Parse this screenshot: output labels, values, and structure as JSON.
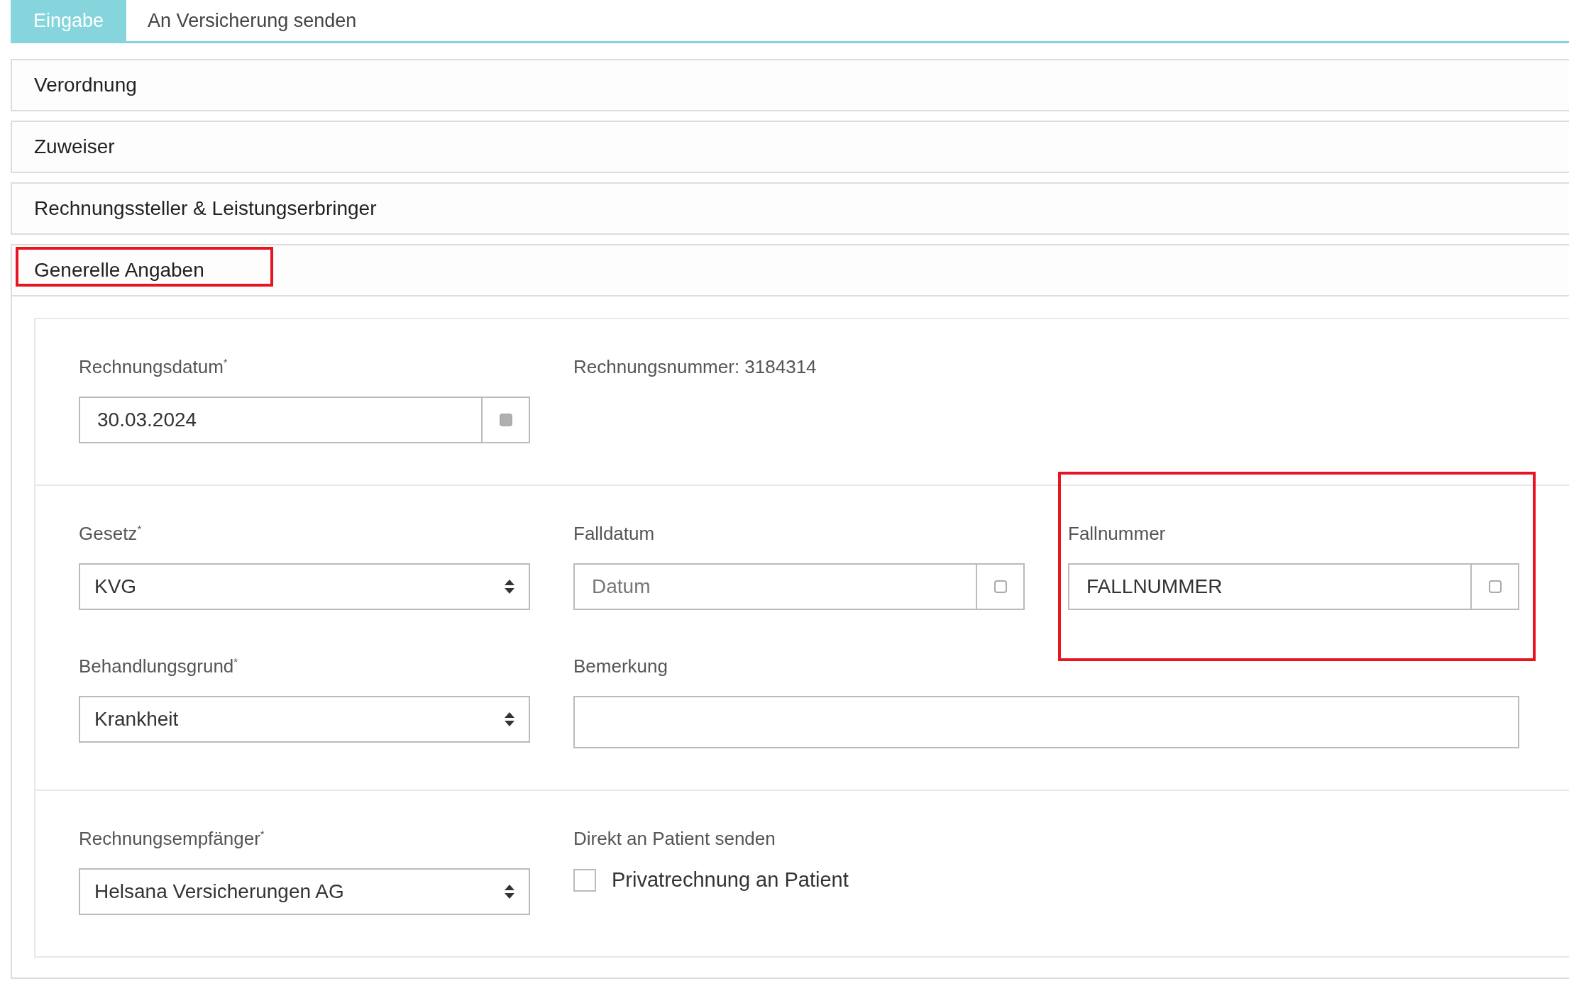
{
  "tabs": [
    {
      "label": "Eingabe",
      "selected": true
    },
    {
      "label": "An Versicherung senden",
      "selected": false
    }
  ],
  "panels": [
    {
      "title": "Verordnung",
      "expanded": false,
      "highlighted": false
    },
    {
      "title": "Zuweiser",
      "expanded": false,
      "highlighted": false
    },
    {
      "title": "Rechnungssteller & Leistungserbringer",
      "expanded": false,
      "highlighted": false
    },
    {
      "title": "Generelle Angaben",
      "expanded": true,
      "highlighted": true
    }
  ],
  "sections": [
    {
      "fields": [
        {
          "kind": "date",
          "label": "Rechnungsdatum$^{*}$",
          "value": "30.03.2024",
          "disabled": true,
          "highlighted": false
        },
        {
          "kind": "info",
          "label": "Rechnungsnummer: 3184314"
        }
      ]
    },
    {
      "fields": [
        {
          "kind": "select",
          "label": "Gesetz$^{*}$",
          "value": "KVG"
        },
        {
          "kind": "date",
          "label": "Falldatum",
          "placeholder": "Datum",
          "disabled": false,
          "highlighted": false
        },
        {
          "kind": "date",
          "label": "Fallnummer",
          "value": "FALLNUMMER",
          "disabled": false,
          "highlighted": true
        },
        {
          "kind": "select",
          "label": "Behandlungsgrund$^{*}$",
          "value": "Krankheit"
        },
        {
          "kind": "textarea",
          "label": "Bemerkung"
        }
      ]
    },
    {
      "fields": [
        {
          "kind": "select",
          "label": "Rechnungsempfänger$^{*}$",
          "value": "Helsana Versicherungen AG"
        },
        {
          "kind": "checkbox",
          "label": "Direkt an Patient senden",
          "option": "Privatrechnung an Patient",
          "checked": false
        }
      ]
    }
  ]
}
